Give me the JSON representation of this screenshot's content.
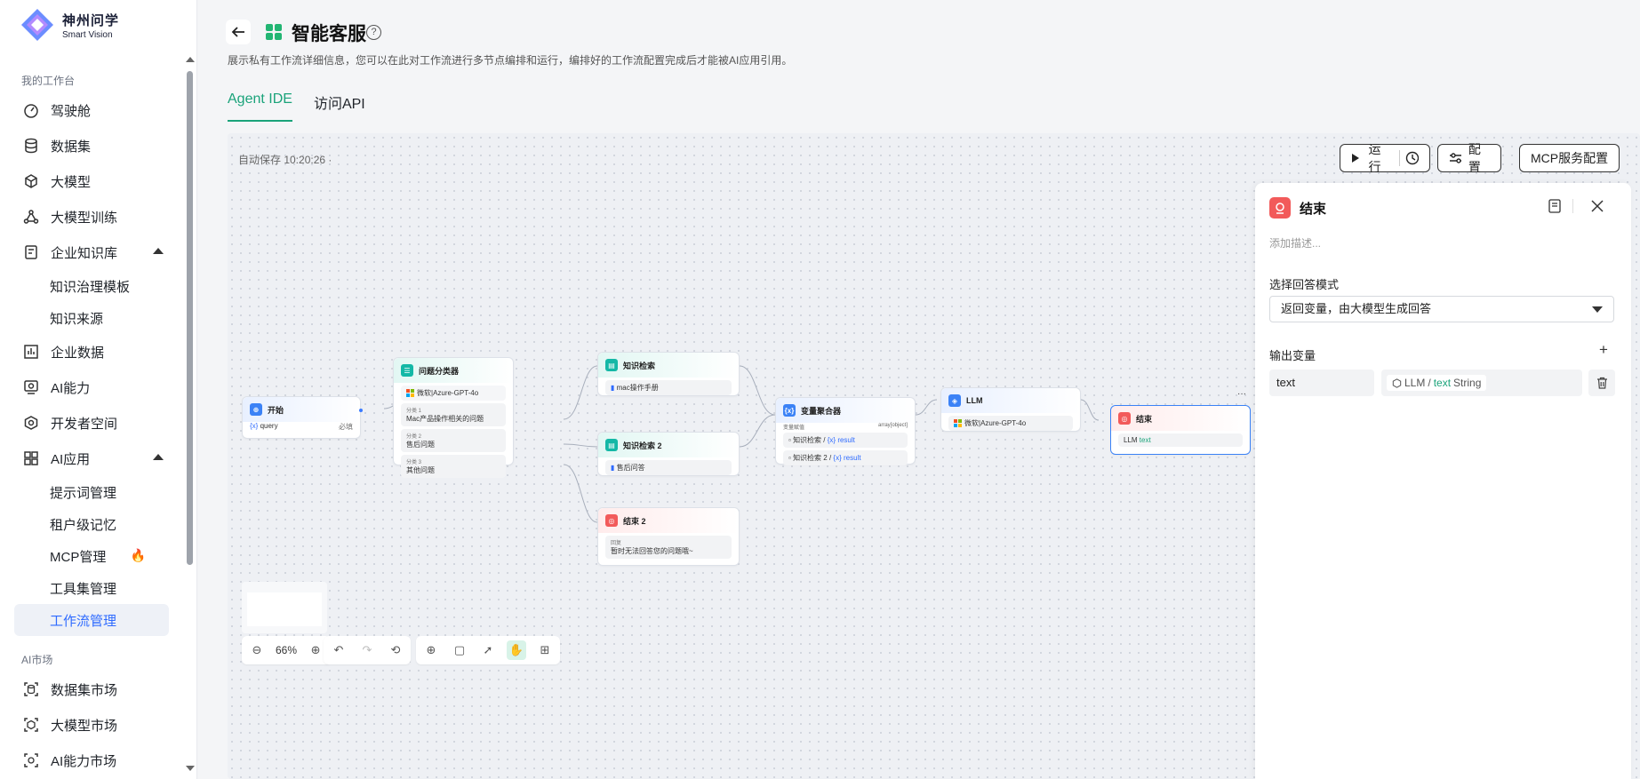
{
  "brand": {
    "name_cn": "神州问学",
    "name_en": "Smart Vision"
  },
  "sidebar": {
    "section_workbench": "我的工作台",
    "items": [
      {
        "label": "驾驶舱",
        "icon": "dashboard-icon"
      },
      {
        "label": "数据集",
        "icon": "database-icon"
      },
      {
        "label": "大模型",
        "icon": "cube-icon"
      },
      {
        "label": "大模型训练",
        "icon": "training-icon"
      },
      {
        "label": "企业知识库",
        "icon": "knowledge-icon"
      },
      {
        "label": "知识治理模板"
      },
      {
        "label": "知识来源"
      },
      {
        "label": "企业数据",
        "icon": "chart-icon"
      },
      {
        "label": "AI能力",
        "icon": "ai-ability-icon"
      },
      {
        "label": "开发者空间",
        "icon": "developer-icon"
      },
      {
        "label": "AI应用",
        "icon": "apps-icon"
      },
      {
        "label": "提示词管理"
      },
      {
        "label": "租户级记忆"
      },
      {
        "label": "MCP管理"
      },
      {
        "label": "工具集管理"
      },
      {
        "label": "工作流管理"
      }
    ],
    "section_market": "AI市场",
    "market_items": [
      {
        "label": "数据集市场"
      },
      {
        "label": "大模型市场"
      },
      {
        "label": "AI能力市场"
      }
    ]
  },
  "header": {
    "title": "智能客服",
    "help": "?",
    "description": "展示私有工作流详细信息，您可以在此对工作流进行多节点编排和运行，编排好的工作流配置完成后才能被AI应用引用。",
    "tabs": [
      {
        "label": "Agent IDE"
      },
      {
        "label": "访问API"
      }
    ]
  },
  "canvas": {
    "autosave": "自动保存 10:20:26 ·",
    "toolbar": {
      "run": "运行",
      "config": "配置",
      "mcp": "MCP服务配置"
    },
    "nodes": {
      "start": {
        "title": "开始",
        "var": "query",
        "required": "必填"
      },
      "classifier": {
        "title": "问题分类器",
        "model": "微软|Azure-GPT-4o",
        "c1_label": "分类 1",
        "c1": "Mac产品操作相关的问题",
        "c2_label": "分类 2",
        "c2": "售后问题",
        "c3_label": "分类 3",
        "c3": "其他问题"
      },
      "kb1": {
        "title": "知识检索",
        "doc": "mac操作手册"
      },
      "kb2": {
        "title": "知识检索 2",
        "doc": "售后问答"
      },
      "end2": {
        "title": "结束 2",
        "label": "回复",
        "reply": "暂时无法回答您的问题哦~"
      },
      "agg": {
        "title": "变量聚合器",
        "label": "变量赋值",
        "type": "array[object]",
        "r1": "知识检索",
        "r2": "知识检索 2",
        "v": "result"
      },
      "llm": {
        "title": "LLM",
        "model": "微软|Azure-GPT-4o"
      },
      "end": {
        "title": "结束",
        "llm": "LLM",
        "v": "text",
        "more": "···"
      }
    },
    "zoom": "66%"
  },
  "panel": {
    "title": "结束",
    "description_placeholder": "添加描述...",
    "mode_label": "选择回答模式",
    "mode_value": "返回变量，由大模型生成回答",
    "output_label": "输出变量",
    "add": "+",
    "var_name": "text",
    "ref_node": "LLM",
    "ref_sep": "/",
    "ref_var": "text",
    "ref_type": "String"
  },
  "colors": {
    "accent_green": "#1aa37a",
    "accent_blue": "#2f6bff",
    "end_red": "#f25a5a"
  }
}
